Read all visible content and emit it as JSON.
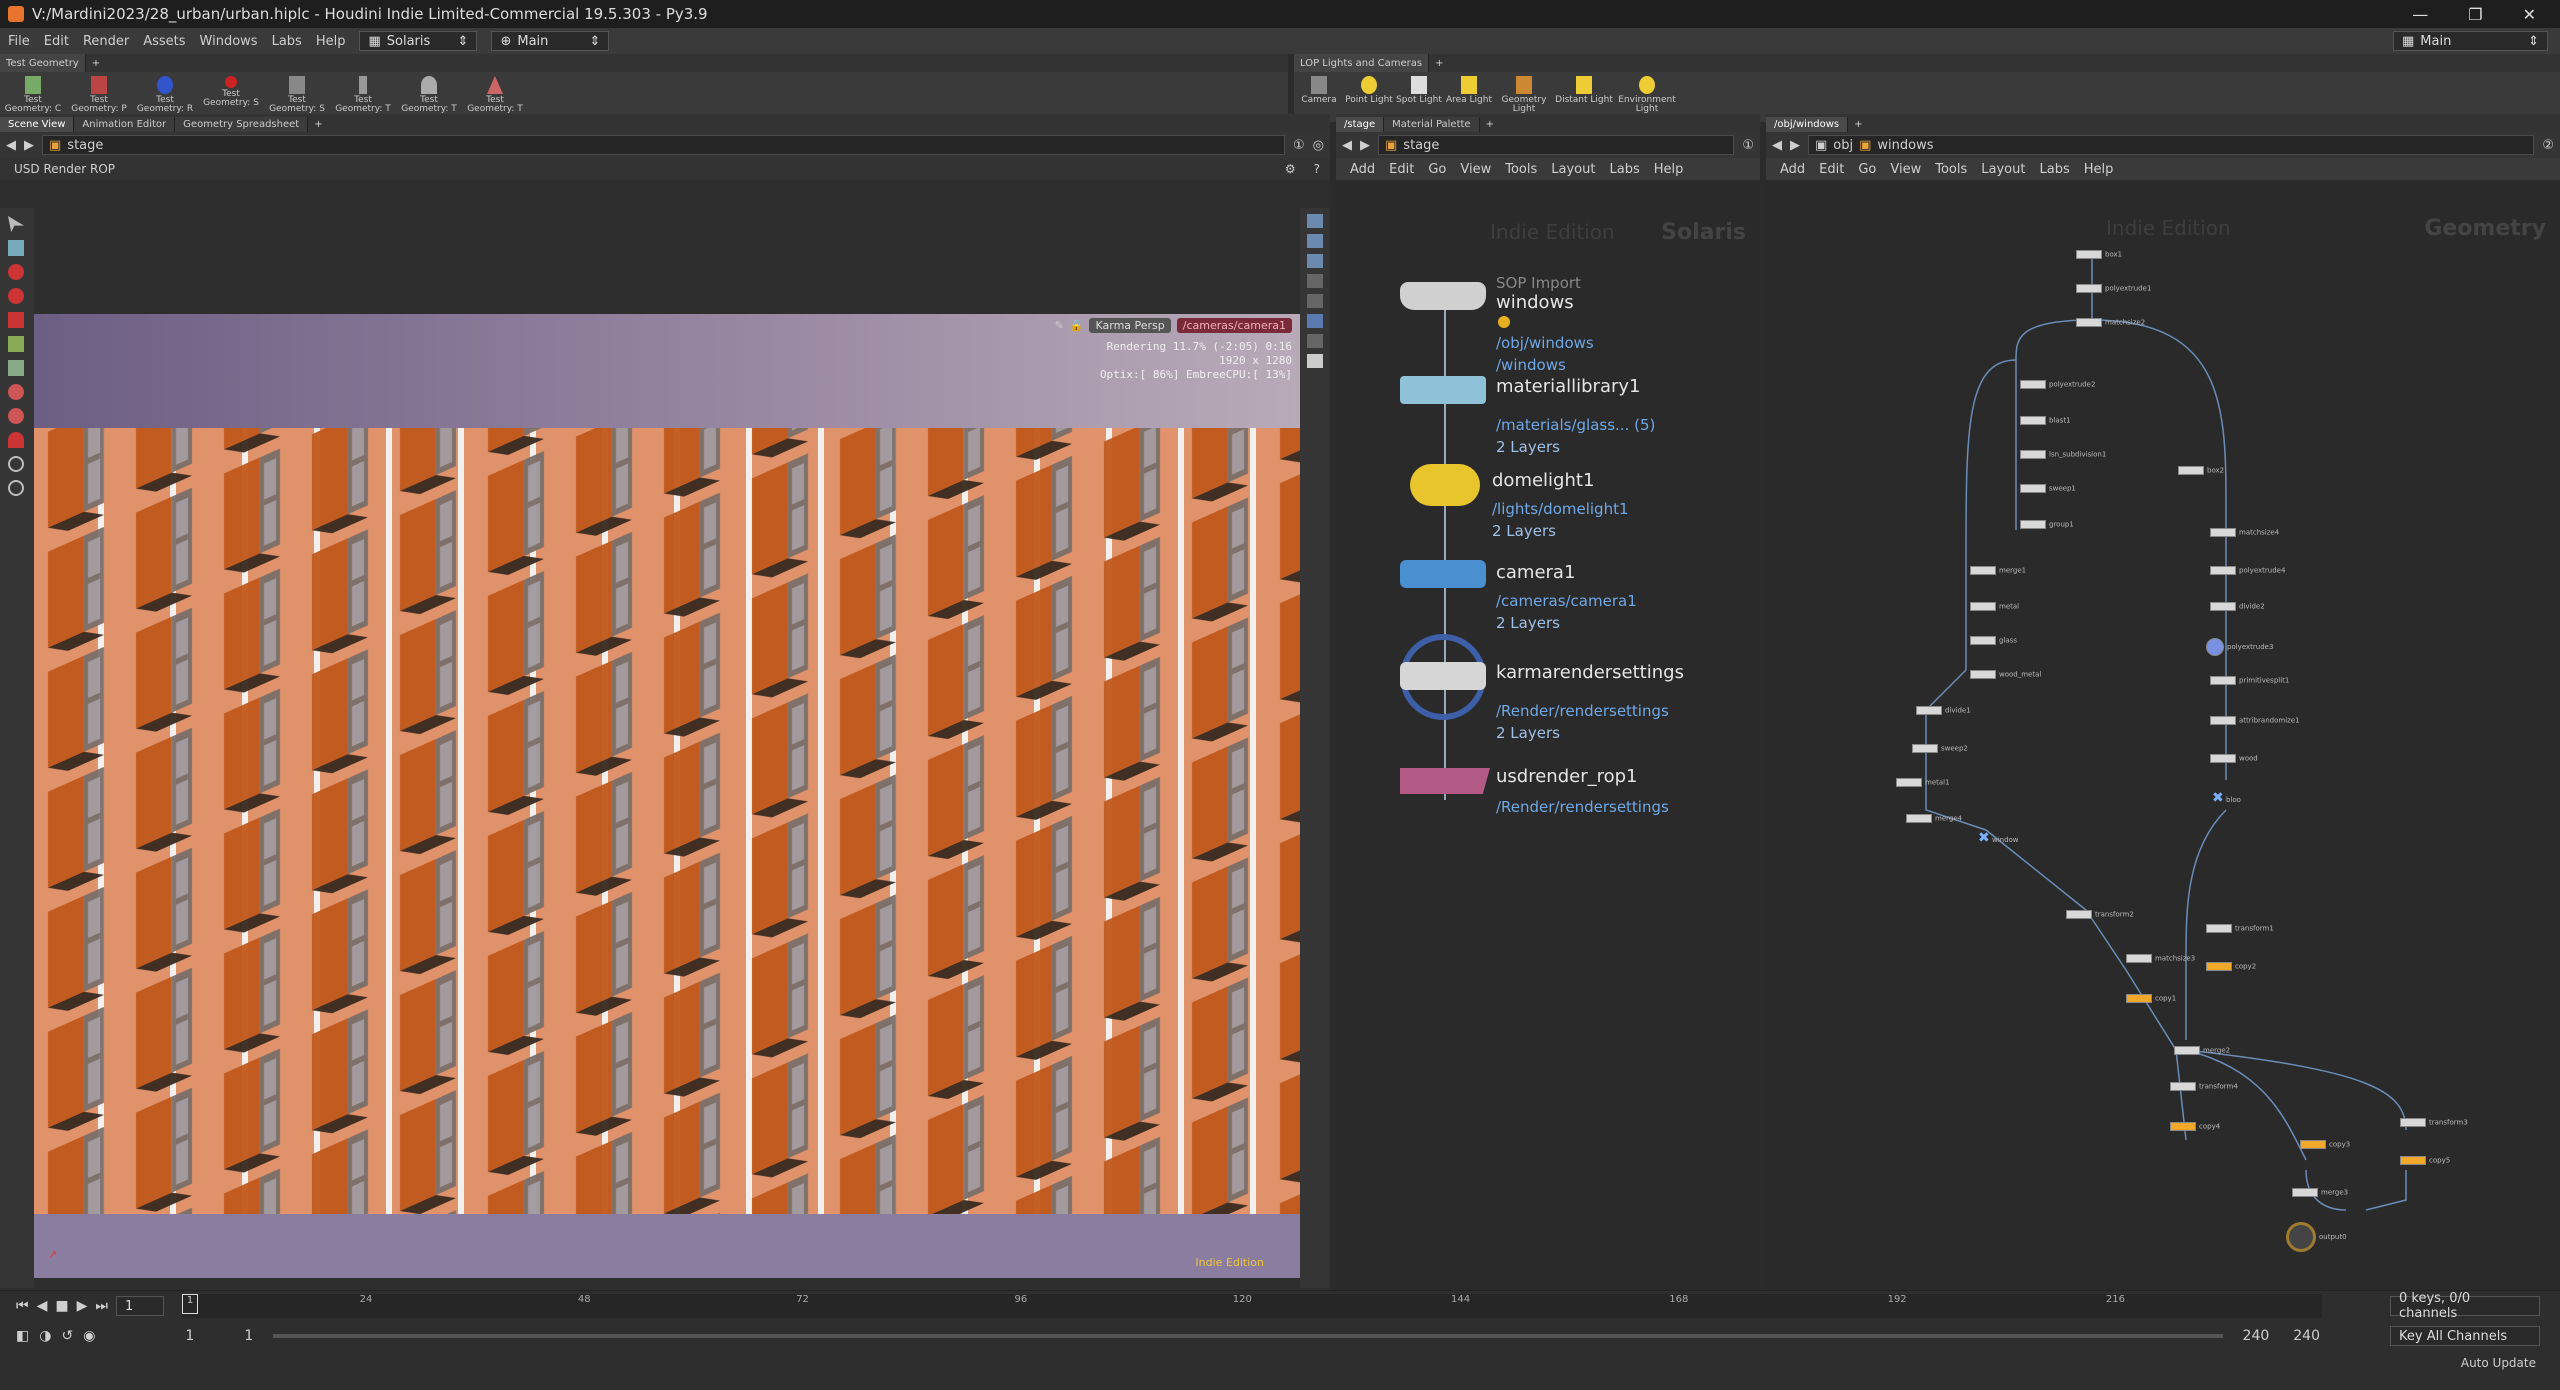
{
  "window": {
    "title": "V:/Mardini2023/28_urban/urban.hiplc - Houdini Indie Limited-Commercial 19.5.303 - Py3.9",
    "min": "—",
    "max": "❐",
    "close": "✕"
  },
  "menu": {
    "items": [
      "File",
      "Edit",
      "Render",
      "Assets",
      "Windows",
      "Labs",
      "Help"
    ],
    "desktop": "Solaris",
    "context": "Main",
    "right_desktop": "Main"
  },
  "shelf_left": {
    "tab": "Test Geometry",
    "tools": [
      "Test Geometry: C",
      "Test Geometry: P",
      "Test Geometry: R",
      "Test Geometry: S",
      "Test Geometry: S",
      "Test Geometry: T",
      "Test Geometry: T",
      "Test Geometry: T"
    ]
  },
  "shelf_right": {
    "tab": "LOP Lights and Cameras",
    "tools": [
      "Camera",
      "Point Light",
      "Spot Light",
      "Area Light",
      "Geometry Light",
      "Distant Light",
      "Environment Light"
    ]
  },
  "viewer": {
    "tabs": [
      "Scene View",
      "Animation Editor",
      "Geometry Spreadsheet"
    ],
    "path": "stage",
    "rop_label": "USD Render ROP",
    "persp": "Karma Persp",
    "camera": "/cameras/camera1",
    "stats": [
      "Rendering  11.7%  (-2:05)  0:16",
      "1920 x 1280",
      "Optix:[ 86%] EmbreeCPU:[ 13%]"
    ],
    "edition": "Indie Edition"
  },
  "stage_net": {
    "tabs": [
      "/stage",
      "Material Palette"
    ],
    "path": "stage",
    "menu": [
      "Add",
      "Edit",
      "Go",
      "View",
      "Tools",
      "Layout",
      "Labs",
      "Help"
    ],
    "watermark": "Indie Edition",
    "context": "Solaris",
    "nodes": [
      {
        "type": "SOP Import",
        "name": "windows",
        "sub": "/obj/windows",
        "info": "/windows",
        "color": "#bcbcbc"
      },
      {
        "name": "materiallibrary1",
        "sub": "/materials/glass... (5)",
        "info": "2 Layers",
        "color": "#8fc2d8"
      },
      {
        "name": "domelight1",
        "sub": "/lights/domelight1",
        "info": "2 Layers",
        "color": "#e8c52c"
      },
      {
        "name": "camera1",
        "sub": "/cameras/camera1",
        "info": "2 Layers",
        "color": "#4a8fcf"
      },
      {
        "name": "karmarendersettings",
        "sub": "/Render/rendersettings",
        "info": "2 Layers",
        "color": "#cfcfcf"
      },
      {
        "name": "usdrender_rop1",
        "sub": "/Render/rendersettings",
        "info": "",
        "color": "#b35b86"
      }
    ]
  },
  "obj_net": {
    "tabs": [
      "/obj/windows"
    ],
    "path_obj": "obj",
    "path": "windows",
    "menu": [
      "Add",
      "Edit",
      "Go",
      "View",
      "Tools",
      "Layout",
      "Labs",
      "Help"
    ],
    "watermark": "Indie Edition",
    "context": "Geometry",
    "nodes": [
      "box1",
      "polyextrude1",
      "matchsize2",
      "polyextrude2",
      "blast1",
      "lsn_subdivision1",
      "sweep1",
      "group1",
      "box2",
      "merge1",
      "matchsize4",
      "metal",
      "polyextrude4",
      "glass",
      "divide2",
      "wood_metal",
      "polyextrude3",
      "divide1",
      "primitivesplit1",
      "sweep2",
      "attribrandomize1",
      "metal1",
      "wood",
      "merge4",
      "window",
      "bloo",
      "transform2",
      "transform1",
      "matchsize3",
      "copy2",
      "copy1",
      "merge2",
      "transform4",
      "copy4",
      "transform3",
      "copy3",
      "copy5",
      "merge3",
      "output0"
    ]
  },
  "timeline": {
    "frame": "1",
    "ticks": [
      "24",
      "48",
      "72",
      "96",
      "120",
      "144",
      "168",
      "192",
      "216"
    ],
    "start": "1",
    "start2": "1",
    "end": "240",
    "end2": "240",
    "keys": "0 keys, 0/0 channels",
    "key_all": "Key All Channels",
    "auto_update": "Auto Update"
  }
}
